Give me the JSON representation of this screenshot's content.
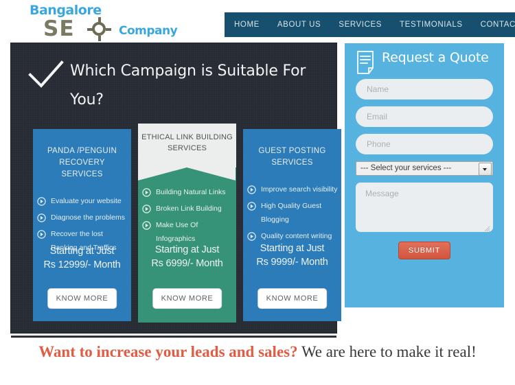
{
  "header": {
    "logo": {
      "top_text": "Bangalore",
      "se_text": "SE",
      "company_text": "Company",
      "target_icon": "target-crosshair-icon",
      "blue": "#3aa6e0",
      "gray": "#7a7a63"
    },
    "nav": {
      "background": "#17506e",
      "items": [
        {
          "label": "HOME"
        },
        {
          "label": "ABOUT US"
        },
        {
          "label": "SERVICES"
        },
        {
          "label": "TESTIMONIALS"
        },
        {
          "label": "CONTACT US"
        }
      ]
    }
  },
  "hero": {
    "check_icon": "checkmark-icon",
    "headline": "Which Campaign is Suitable For You?",
    "background": "#272b33"
  },
  "cards": [
    {
      "title": "PANDA /PENGUIN RECOVERY SERVICES",
      "color": "#2b7cb8",
      "style": "plain",
      "features": [
        "Evaluate your website",
        "Diagnose the problems",
        "Recover the lost Ranking and Traffics"
      ],
      "price_line1": "Starting at Just",
      "price_line2": "Rs 12999/- Month",
      "cta": "KNOW MORE"
    },
    {
      "title": "ETHICAL LINK BUILDING SERVICES",
      "color": "#379377",
      "style": "featured",
      "features": [
        "Building Natural Links",
        "Broken Link Building",
        "Make Use Of Infographics"
      ],
      "price_line1": "Starting at Just",
      "price_line2": "Rs 6999/- Month",
      "cta": "KNOW MORE"
    },
    {
      "title": "GUEST POSTING SERVICES",
      "color": "#2b7cb8",
      "style": "plain",
      "features": [
        "Improve search visibility",
        "High Quality Guest Blogging",
        "Quality content writing"
      ],
      "price_line1": "Starting at Just",
      "price_line2": "Rs 9999/- Month",
      "cta": "KNOW MORE"
    }
  ],
  "quote": {
    "title": "Request a Quote",
    "doc_icon": "document-quote-icon",
    "background": "#56b3e0",
    "name_placeholder": "Name",
    "name_value": "",
    "email_placeholder": "Email",
    "email_value": "",
    "phone_placeholder": "Phone",
    "phone_value": "",
    "services_selected": "--- Select your services ---",
    "message_placeholder": "Message",
    "message_value": "",
    "submit_label": "SUBMIT",
    "submit_color": "#d1563f"
  },
  "footer": {
    "highlight": "Want to increase your leads and sales?",
    "rest": " We are here to make it real!",
    "highlight_color": "#e05c43"
  }
}
